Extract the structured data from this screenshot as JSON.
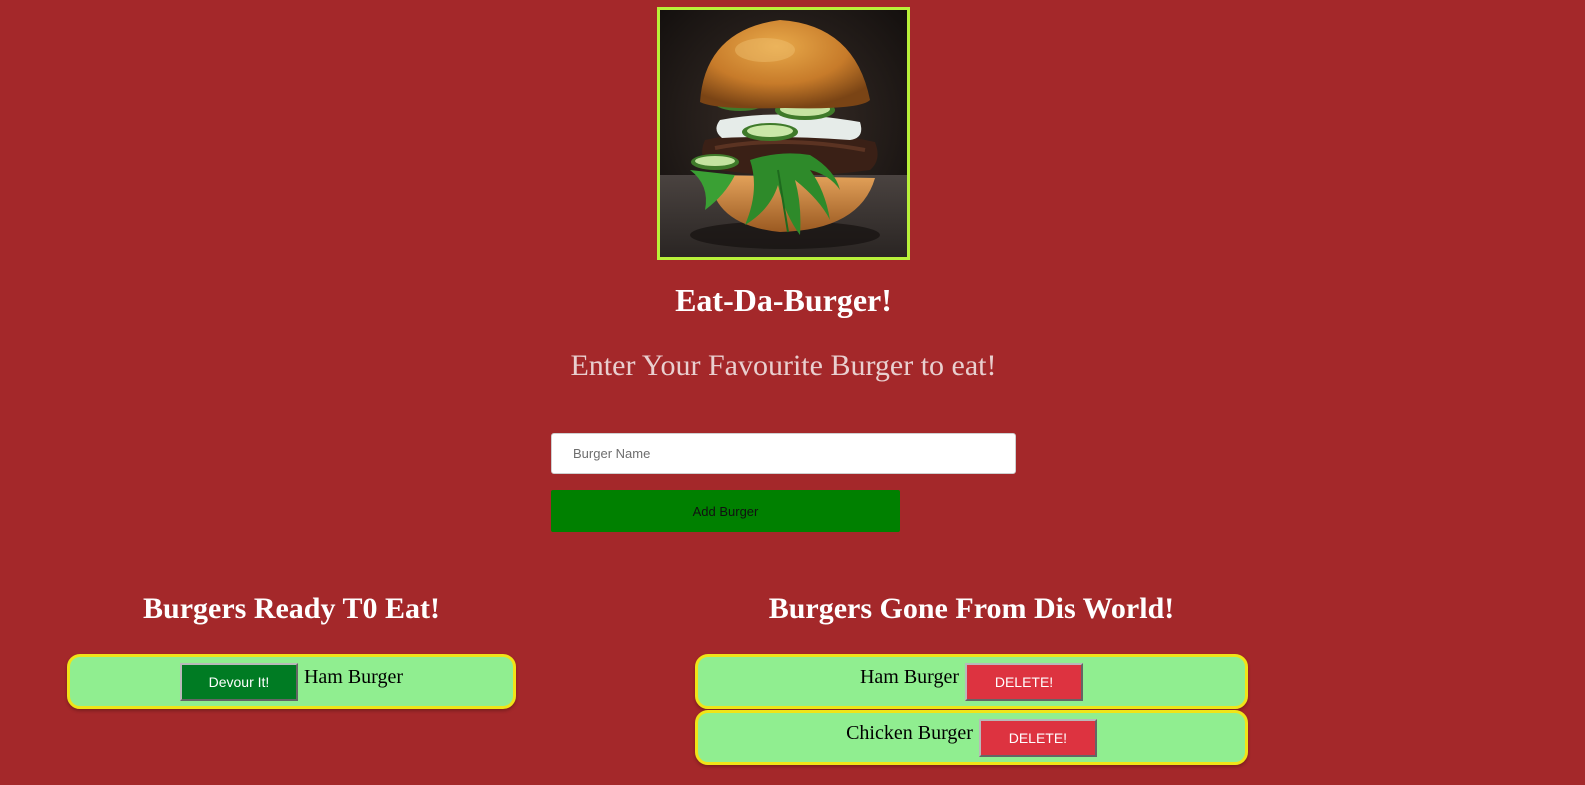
{
  "header": {
    "hero_image": "burger-photo",
    "title": "Eat-Da-Burger!",
    "subtitle": "Enter Your Favourite Burger to eat!"
  },
  "form": {
    "input_value": "",
    "input_placeholder": "Burger Name",
    "submit_label": "Add Burger"
  },
  "ready": {
    "heading": "Burgers Ready T0 Eat!",
    "items": [
      {
        "name": "Ham Burger",
        "button_label": "Devour It!"
      }
    ]
  },
  "devoured": {
    "heading": "Burgers Gone From Dis World!",
    "items": [
      {
        "name": "Ham Burger",
        "button_label": "DELETE!"
      },
      {
        "name": "Chicken Burger",
        "button_label": "DELETE!"
      }
    ]
  },
  "colors": {
    "background": "#a4282a",
    "image_border": "#b8f03a",
    "add_button": "#008000",
    "card_background": "#90ee90",
    "card_border": "#f0e418",
    "devour_button": "#007b23",
    "delete_button": "#dd3340"
  }
}
